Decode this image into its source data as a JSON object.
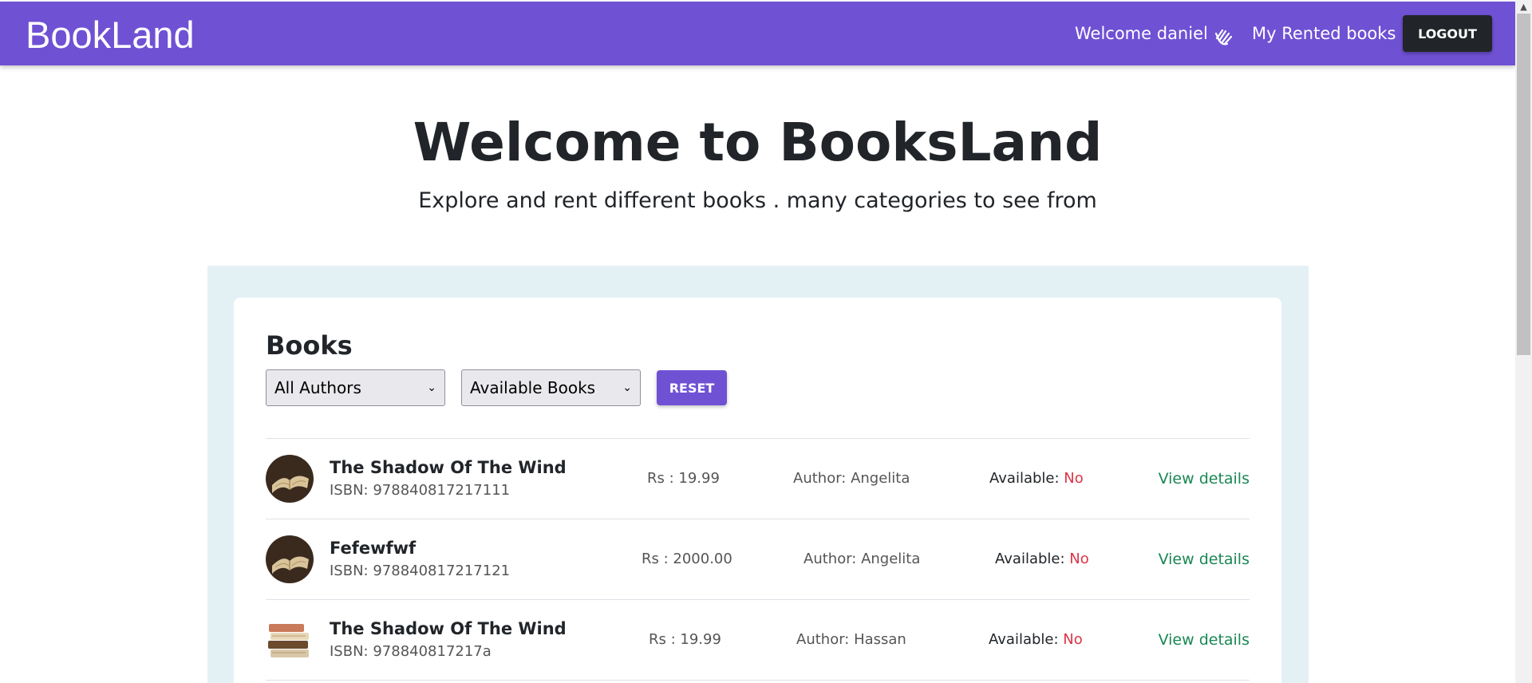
{
  "nav": {
    "brand": "BookLand",
    "welcome": "Welcome daniel",
    "rented_link": "My Rented books",
    "logout": "LOGOUT"
  },
  "hero": {
    "title": "Welcome to BooksLand",
    "subtitle": "Explore and rent different books . many categories to see from"
  },
  "books": {
    "heading": "Books",
    "author_filter": "All Authors",
    "availability_filter": "Available Books",
    "reset": "RESET",
    "rows": [
      {
        "title": "The Shadow Of The Wind",
        "isbn": "ISBN: 978840817217111",
        "price": "Rs : 19.99",
        "author": "Author: Angelita",
        "avail_label": "Available:",
        "avail_value": "No",
        "link": "View details",
        "thumb": "open-book"
      },
      {
        "title": "Fefewfwf",
        "isbn": "ISBN: 978840817217121",
        "price": "Rs : 2000.00",
        "author": "Author: Angelita",
        "avail_label": "Available:",
        "avail_value": "No",
        "link": "View details",
        "thumb": "open-book"
      },
      {
        "title": "The Shadow Of The Wind",
        "isbn": "ISBN: 978840817217a",
        "price": "Rs : 19.99",
        "author": "Author: Hassan",
        "avail_label": "Available:",
        "avail_value": "No",
        "link": "View details",
        "thumb": "book-stack"
      }
    ]
  },
  "colors": {
    "navbar": "#6f51d4",
    "panel": "#e3f1f5",
    "link_green": "#198754",
    "no_red": "#dc3545"
  }
}
